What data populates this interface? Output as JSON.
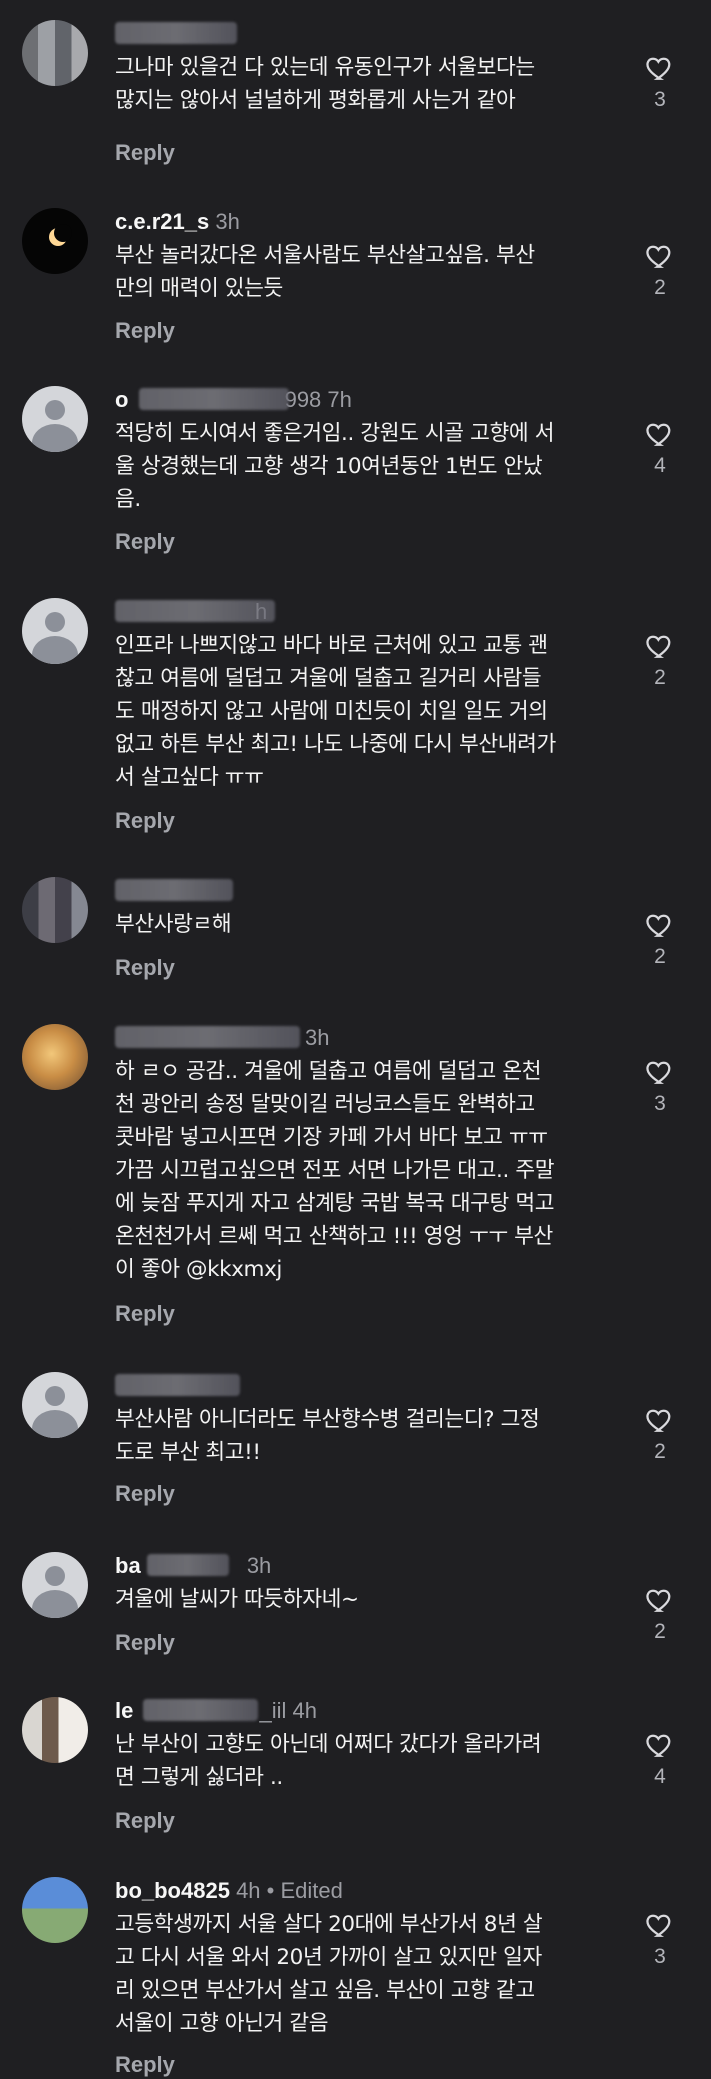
{
  "labels": {
    "reply": "Reply",
    "edited": "Edited",
    "separator": "•"
  },
  "icons": {
    "like": "heart-outline-icon",
    "default_avatar": "person-silhouette-icon"
  },
  "colors": {
    "background": "#1f1f22",
    "text": "#f3f3f3",
    "muted": "#9b9ca2"
  },
  "comments": [
    {
      "username": "",
      "time": "",
      "text": "그나마 있을건 다 있는데 유동인구가 서울보다는\n많지는 않아서 널널하게 평화롭게 사는거 같아",
      "likes": "3",
      "avatar": "pixelated"
    },
    {
      "username": "c.e.r21_s",
      "time": "3h",
      "text": "부산 놀러갔다온 서울사람도 부산살고싶음. 부산\n만의 매력이 있는듯",
      "likes": "2",
      "avatar": "moon"
    },
    {
      "username": "o",
      "time": "998 7h",
      "text": "적당히 도시여서 좋은거임.. 강원도 시골 고향에 서\n울 상경했는데 고향 생각 10여년동안 1번도 안났\n음.",
      "likes": "4",
      "avatar": "default"
    },
    {
      "username": "",
      "time": "h",
      "text": "인프라 나쁘지않고 바다 바로 근처에 있고 교통 괜\n찮고 여름에 덜덥고 겨울에 덜춥고 길거리 사람들\n도 매정하지 않고 사람에 미친듯이 치일 일도 거의\n없고 하튼 부산 최고! 나도 나중에 다시 부산내려가\n서 살고싶다 ㅠㅠ",
      "likes": "2",
      "avatar": "default"
    },
    {
      "username": "",
      "time": "",
      "text": "부산사랑ㄹ해",
      "likes": "2",
      "avatar": "dark-pixelated"
    },
    {
      "username": "",
      "time": "3h",
      "text": "하 ㄹㅇ 공감.. 겨울에 덜춥고 여름에 덜덥고 온천\n천 광안리 송정 달맞이길 러닝코스들도 완벽하고\n콧바람 넣고시프면 기장 카페 가서 바다 보고 ㅠㅠ\n가끔 시끄럽고싶으면 전포 서면 나가믄 대고.. 주말\n에 늦잠 푸지게 자고 삼계탕 국밥 복국 대구탕 먹고\n온천천가서 르쎄 먹고 산책하고 !!! 영엉 ㅜㅜ 부산\n이 좋아 @kkxmxj",
      "likes": "3",
      "avatar": "cat"
    },
    {
      "username": "",
      "time": "",
      "text": "부산사람 아니더라도 부산향수병 걸리는디? 그정\n도로 부산 최고!!",
      "likes": "2",
      "avatar": "default"
    },
    {
      "username": "ba",
      "time": "3h",
      "text": "겨울에 날씨가 따듯하자네~",
      "likes": "2",
      "avatar": "default"
    },
    {
      "username": "le",
      "time": "_iil 4h",
      "text": "난 부산이 고향도 아닌데 어쩌다 갔다가 올라가려\n면 그렇게 싫더라 ..",
      "likes": "4",
      "avatar": "portrait"
    },
    {
      "username": "bo_bo4825",
      "time": "4h",
      "text": "고등학생까지 서울 살다 20대에 부산가서 8년 살\n고 다시 서울 와서 20년 가까이 살고 있지만 일자\n리 있으면 부산가서 살고 싶음. 부산이 고향 같고\n서울이 고향 아닌거 같음",
      "likes": "3",
      "avatar": "blue"
    }
  ]
}
